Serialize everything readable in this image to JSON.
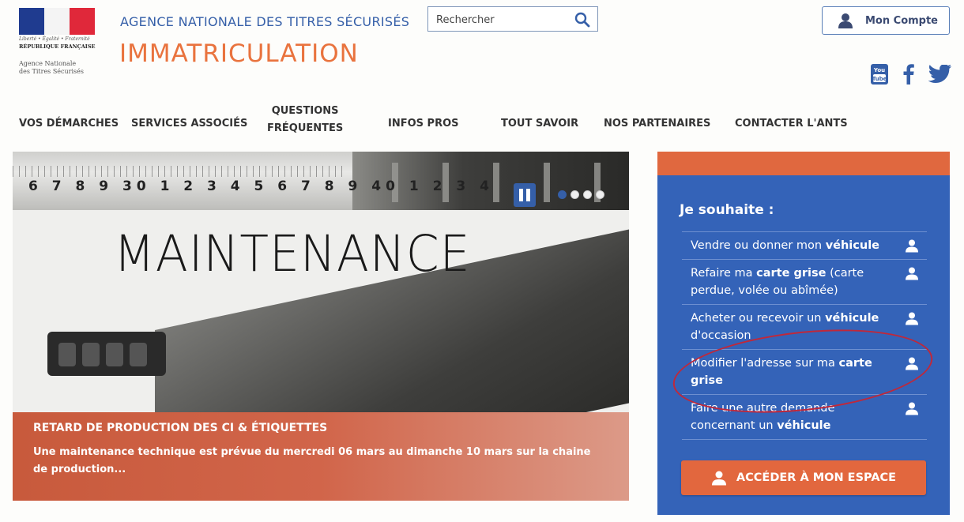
{
  "header": {
    "logo": {
      "motto": "Liberté • Égalité • Fraternité",
      "republic": "RÉPUBLIQUE FRANÇAISE",
      "agency": "Agence Nationale\ndes Titres Sécurisés"
    },
    "subtitle": "AGENCE NATIONALE DES TITRES SÉCURISÉS",
    "title": "IMMATRICULATION",
    "search": {
      "placeholder": "Rechercher",
      "icon": "search-icon"
    },
    "account": {
      "label": "Mon Compte",
      "icon": "user-icon"
    },
    "social": [
      {
        "name": "youtube",
        "icon": "youtube-icon",
        "text": "You Tube",
        "color": "#355fa8"
      },
      {
        "name": "facebook",
        "icon": "facebook-icon",
        "text": "f",
        "color": "#355fa8"
      },
      {
        "name": "twitter",
        "icon": "twitter-icon",
        "color": "#355fa8"
      }
    ]
  },
  "nav": {
    "items": [
      {
        "id": "vos-demarches",
        "label": "VOS DÉMARCHES"
      },
      {
        "id": "services-associes",
        "label": "SERVICES ASSOCIÉS"
      },
      {
        "id": "questions-frequentes",
        "line1": "QUESTIONS",
        "line2": "FRÉQUENTES"
      },
      {
        "id": "infos-pros",
        "label": "INFOS PROS"
      },
      {
        "id": "tout-savoir",
        "label": "TOUT SAVOIR"
      },
      {
        "id": "nos-partenaires",
        "label": "NOS PARTENAIRES"
      },
      {
        "id": "contacter",
        "label": "CONTACTER L'ANTS"
      }
    ]
  },
  "hero": {
    "ruler_numbers": "6 7 8 9 30 1 2 3 4 5 6 7 8 9 40 1 2 3 4",
    "maintenance_text": "MAINTENANCE",
    "slider": {
      "pause_icon": "pause-icon",
      "slide_count": 4,
      "active_index": 0
    },
    "caption": {
      "title": "RETARD DE PRODUCTION DES CI & ÉTIQUETTES",
      "body": "Une maintenance technique est prévue du mercredi 06 mars au dimanche 10 mars sur la chaine de production..."
    }
  },
  "panel": {
    "title": "Je souhaite :",
    "items": [
      {
        "parts": [
          "Vendre ou donner mon ",
          "véhicule",
          ""
        ]
      },
      {
        "parts": [
          "Refaire ma ",
          "carte grise",
          " (carte perdue, volée ou abîmée)"
        ]
      },
      {
        "parts": [
          "Acheter ou recevoir un ",
          "véhicule",
          " d'occasion"
        ]
      },
      {
        "parts": [
          "Modifier l'adresse sur ma ",
          "carte grise",
          ""
        ]
      },
      {
        "parts": [
          "Faire une autre demande concernant un ",
          "véhicule",
          ""
        ]
      }
    ],
    "item_icon": "user-icon",
    "button": {
      "label": "ACCÉDER À MON ESPACE",
      "icon": "user-icon"
    },
    "colors": {
      "panel": "#3463b8",
      "accent": "#e2673e",
      "annotation": "#c0283a"
    }
  }
}
